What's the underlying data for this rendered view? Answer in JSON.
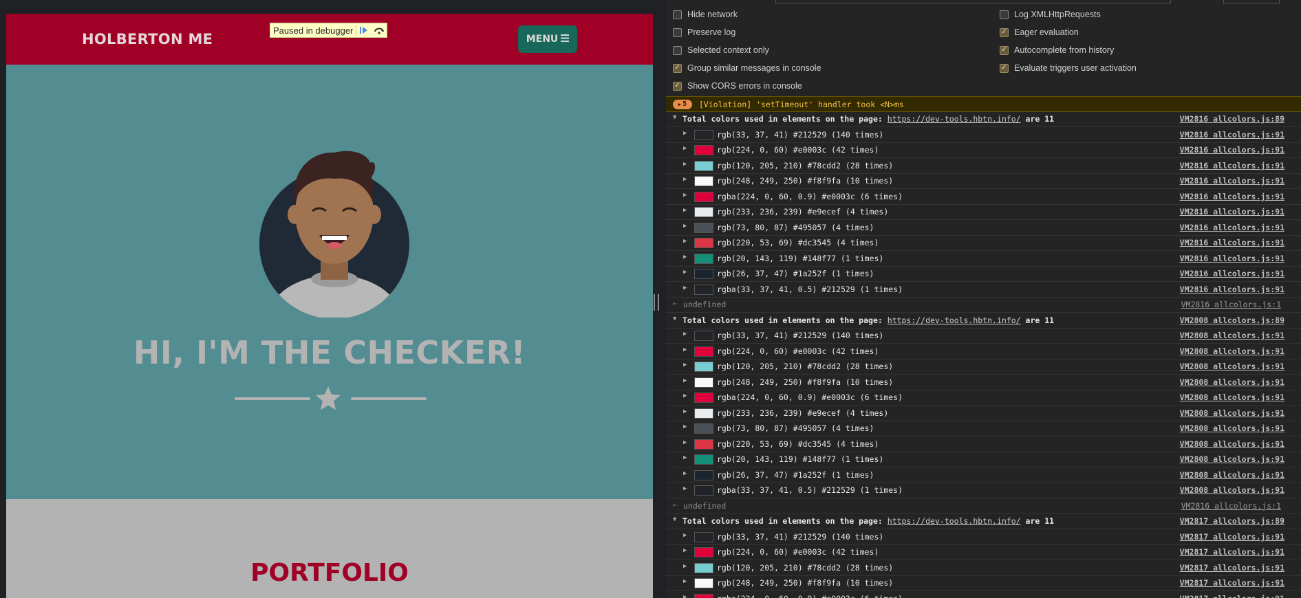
{
  "site": {
    "brand": "HOLBERTON ME",
    "menu_label": "MENU",
    "hero_title": "HI, I'M THE CHECKER!",
    "section_title": "PORTFOLIO",
    "colors": {
      "navbar": "#a00026",
      "masthead": "#538c91",
      "menu_button": "#17685b"
    }
  },
  "debugger": {
    "paused_label": "Paused in debugger"
  },
  "settings": {
    "left": [
      {
        "label": "Hide network",
        "checked": false
      },
      {
        "label": "Preserve log",
        "checked": false
      },
      {
        "label": "Selected context only",
        "checked": false
      },
      {
        "label": "Group similar messages in console",
        "checked": true
      },
      {
        "label": "Show CORS errors in console",
        "checked": true
      }
    ],
    "right": [
      {
        "label": "Log XMLHttpRequests",
        "checked": false
      },
      {
        "label": "Eager evaluation",
        "checked": true
      },
      {
        "label": "Autocomplete from history",
        "checked": true
      },
      {
        "label": "Evaluate triggers user activation",
        "checked": true
      }
    ]
  },
  "console": {
    "violation": {
      "count": "5",
      "text": "[Violation] 'setTimeout' handler took <N>ms"
    },
    "header_text": "Total colors used in elements on the page:",
    "header_url": "https://dev-tools.hbtn.info/",
    "header_suffix": "are 11",
    "undefined_label": "undefined",
    "colors": [
      {
        "text": "rgb(33, 37, 41) #212529 (140 times)",
        "hex": "#212529"
      },
      {
        "text": "rgb(224, 0, 60) #e0003c (42 times)",
        "hex": "#e0003c"
      },
      {
        "text": "rgb(120, 205, 210) #78cdd2 (28 times)",
        "hex": "#78cdd2"
      },
      {
        "text": "rgb(248, 249, 250) #f8f9fa (10 times)",
        "hex": "#f8f9fa"
      },
      {
        "text": "rgba(224, 0, 60, 0.9) #e0003c (6 times)",
        "hex": "#e0003c"
      },
      {
        "text": "rgb(233, 236, 239) #e9ecef (4 times)",
        "hex": "#e9ecef"
      },
      {
        "text": "rgb(73, 80, 87) #495057 (4 times)",
        "hex": "#495057"
      },
      {
        "text": "rgb(220, 53, 69) #dc3545 (4 times)",
        "hex": "#dc3545"
      },
      {
        "text": "rgb(20, 143, 119) #148f77 (1 times)",
        "hex": "#148f77"
      },
      {
        "text": "rgb(26, 37, 47) #1a252f (1 times)",
        "hex": "#1a252f"
      },
      {
        "text": "rgba(33, 37, 41, 0.5) #212529 (1 times)",
        "hex": "#212529"
      }
    ],
    "groups": [
      {
        "vm": "VM2816",
        "header_src": "VM2816 allcolors.js:89",
        "item_src": "VM2816 allcolors.js:91",
        "undefined_src": "VM2816 allcolors.js:1",
        "visible_items": 11
      },
      {
        "vm": "VM2808",
        "header_src": "VM2808 allcolors.js:89",
        "item_src": "VM2808 allcolors.js:91",
        "undefined_src": "VM2816 allcolors.js:1",
        "visible_items": 11
      },
      {
        "vm": "VM2817",
        "header_src": "VM2817 allcolors.js:89",
        "item_src": "VM2817 allcolors.js:91",
        "undefined_src": "",
        "visible_items": 5
      }
    ]
  }
}
